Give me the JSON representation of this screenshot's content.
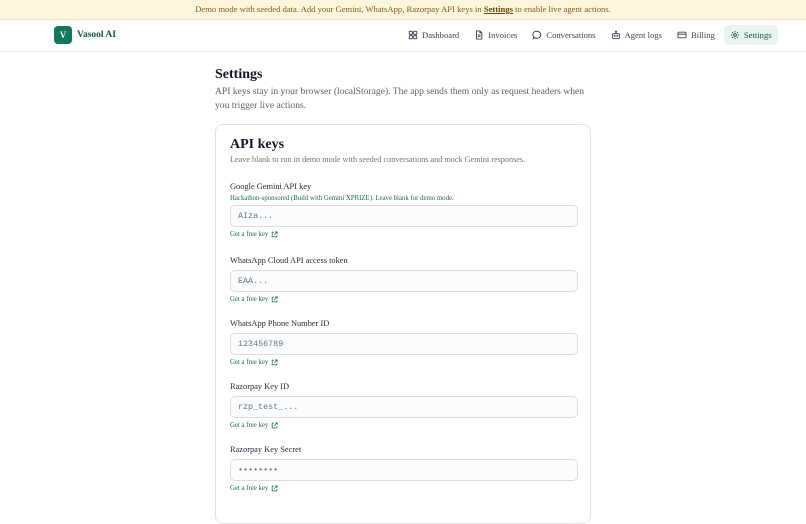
{
  "banner": {
    "before": "Demo mode with seeded data. Add your Gemini, WhatsApp, Razorpay API keys in ",
    "link": "Settings",
    "after": " to enable live agent actions."
  },
  "brand": {
    "logo_letter": "V",
    "name": "Vasool AI"
  },
  "nav": {
    "items": [
      {
        "label": "Dashboard",
        "icon": "dashboard-icon",
        "active": false
      },
      {
        "label": "Invoices",
        "icon": "file-text-icon",
        "active": false
      },
      {
        "label": "Conversations",
        "icon": "chat-bubble-icon",
        "active": false
      },
      {
        "label": "Agent logs",
        "icon": "bot-icon",
        "active": false
      },
      {
        "label": "Billing",
        "icon": "credit-card-icon",
        "active": false
      },
      {
        "label": "Settings",
        "icon": "gear-icon",
        "active": true
      }
    ]
  },
  "page": {
    "title": "Settings",
    "description": "API keys stay in your browser (localStorage). The app sends them only as request headers when you trigger live actions."
  },
  "card": {
    "title": "API keys",
    "subtitle": "Leave blank to run in demo mode with seeded conversations and mock Gemini responses."
  },
  "fields": [
    {
      "label": "Google Gemini API key",
      "hint": "Hackathon-sponsored (Build with Gemini XPRIZE). Leave blank for demo mode.",
      "placeholder": "AIza...",
      "link": "Get a free key"
    },
    {
      "label": "WhatsApp Cloud API access token",
      "hint": "",
      "placeholder": "EAA...",
      "link": "Get a free key"
    },
    {
      "label": "WhatsApp Phone Number ID",
      "hint": "",
      "placeholder": "123456789",
      "link": "Get a free key"
    },
    {
      "label": "Razorpay Key ID",
      "hint": "",
      "placeholder": "rzp_test_...",
      "link": "Get a free key"
    },
    {
      "label": "Razorpay Key Secret",
      "hint": "",
      "placeholder": "••••••••",
      "link": "Get a free key"
    }
  ]
}
